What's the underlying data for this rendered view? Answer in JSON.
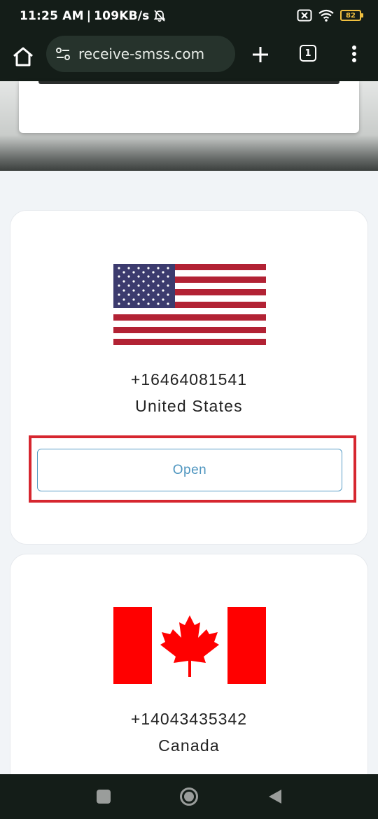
{
  "status_bar": {
    "time": "11:25 AM",
    "separator": "|",
    "speed": "109KB/s",
    "battery_level": "82",
    "icons": [
      "mute-bell-icon",
      "sim-x-icon",
      "wifi-icon",
      "battery-icon"
    ]
  },
  "browser": {
    "url": "receive-smss.com",
    "tab_count": "1",
    "icons": [
      "home-icon",
      "site-settings-icon",
      "new-tab-plus-icon",
      "tab-switcher-icon",
      "more-menu-icon"
    ]
  },
  "cards": [
    {
      "phone": "+16464081541",
      "country": "United States",
      "button_label": "Open",
      "flag": "us-flag"
    },
    {
      "phone": "+14043435342",
      "country": "Canada",
      "flag": "canada-flag"
    }
  ],
  "navigation": {
    "icons": [
      "recents-square-icon",
      "home-circle-icon",
      "back-triangle-icon"
    ]
  },
  "colors": {
    "system_bar": "#141d18",
    "url_bar": "#26332c",
    "page_background": "#f1f4f7",
    "button_text": "#4e95bf",
    "highlight": "#d6262f",
    "us_red": "#b22234",
    "us_blue": "#3c3b6e",
    "canada_red": "#ff0000"
  }
}
